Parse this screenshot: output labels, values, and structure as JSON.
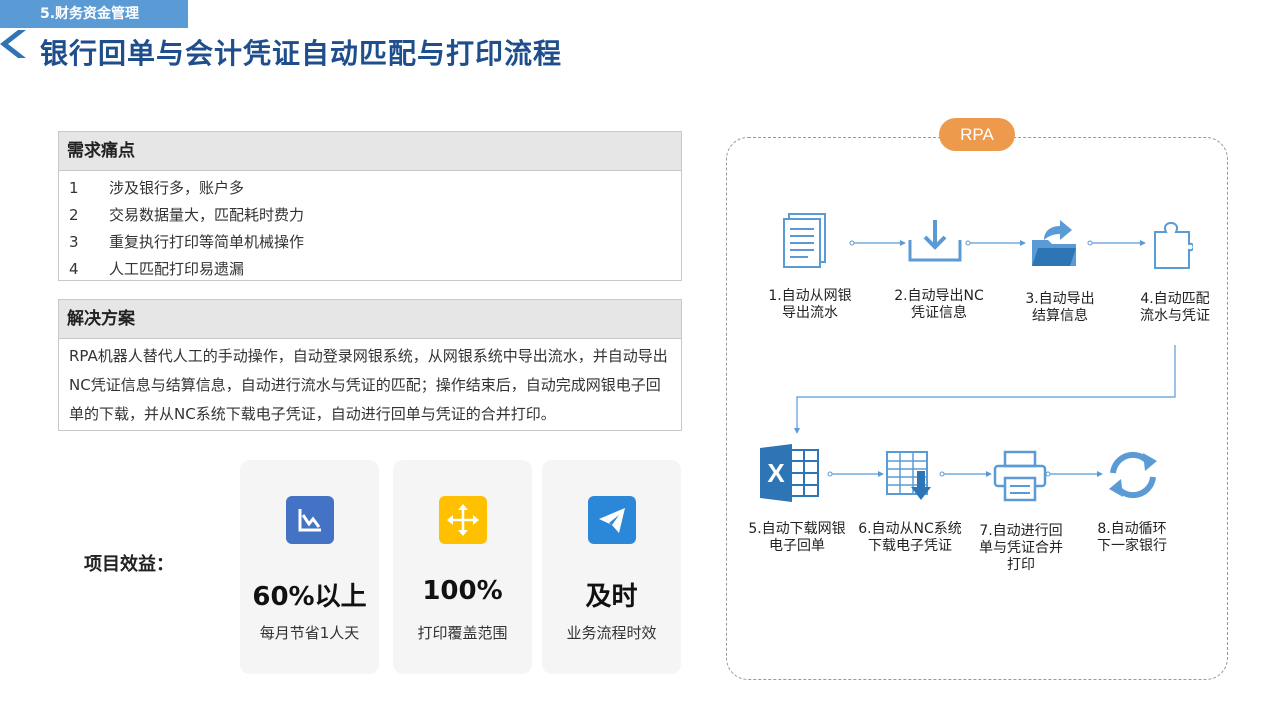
{
  "header": {
    "section_tag": "5.财务资金管理",
    "title": "银行回单与会计凭证自动匹配与打印流程"
  },
  "pain_points": {
    "title": "需求痛点",
    "items": [
      {
        "num": "1",
        "text": "涉及银行多，账户多"
      },
      {
        "num": "2",
        "text": "交易数据量大，匹配耗时费力"
      },
      {
        "num": "3",
        "text": "重复执行打印等简单机械操作"
      },
      {
        "num": "4",
        "text": "人工匹配打印易遗漏"
      }
    ]
  },
  "solution": {
    "title": "解决方案",
    "text": "RPA机器人替代人工的手动操作，自动登录网银系统，从网银系统中导出流水，并自动导出NC凭证信息与结算信息，自动进行流水与凭证的匹配；操作结束后，自动完成网银电子回单的下载，并从NC系统下载电子凭证，自动进行回单与凭证的合并打印。"
  },
  "benefits": {
    "label": "项目效益：",
    "cards": [
      {
        "value": "60%以上",
        "desc": "每月节省1人天",
        "icon": "chart-down-icon",
        "color": "#4472c4"
      },
      {
        "value": "100%",
        "desc": "打印覆盖范围",
        "icon": "move-arrows-icon",
        "color": "#ffc000"
      },
      {
        "value": "及时",
        "desc": "业务流程时效",
        "icon": "paper-plane-icon",
        "color": "#2b88d8"
      }
    ]
  },
  "rpa": {
    "badge": "RPA",
    "steps": [
      {
        "label_lines": [
          "1.自动从网银",
          "导出流水"
        ],
        "icon": "document-icon"
      },
      {
        "label_lines": [
          "2.自动导出NC",
          "凭证信息"
        ],
        "icon": "download-tray-icon"
      },
      {
        "label_lines": [
          "3.自动导出",
          "结算信息"
        ],
        "icon": "folder-export-icon"
      },
      {
        "label_lines": [
          "4.自动匹配",
          "流水与凭证"
        ],
        "icon": "puzzle-icon"
      },
      {
        "label_lines": [
          "5.自动下载网银",
          "电子回单"
        ],
        "icon": "excel-icon"
      },
      {
        "label_lines": [
          "6.自动从NC系统",
          "下载电子凭证"
        ],
        "icon": "spreadsheet-download-icon"
      },
      {
        "label_lines": [
          "7.自动进行回",
          "单与凭证合并",
          "打印"
        ],
        "icon": "printer-icon"
      },
      {
        "label_lines": [
          "8.自动循环",
          "下一家银行"
        ],
        "icon": "refresh-icon"
      }
    ]
  },
  "colors": {
    "accent": "#5b9bd5",
    "title": "#1f4e8c",
    "rpa_badge": "#ee9a4d"
  }
}
